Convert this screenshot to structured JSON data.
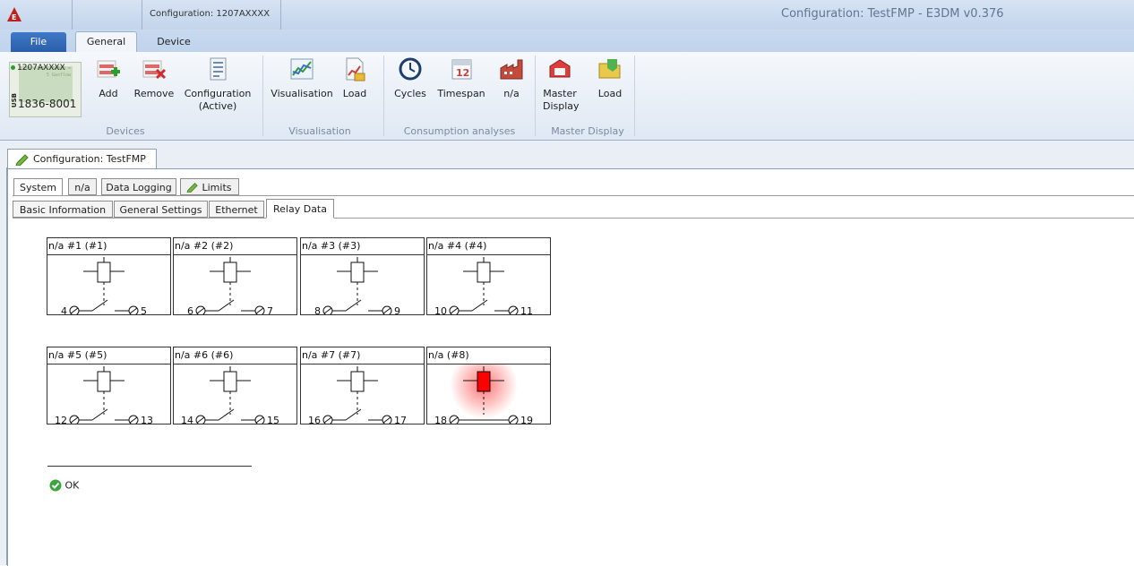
{
  "window": {
    "document_title": "Configuration: 1207AXXXX",
    "app_title": "Configuration: TestFMP - E3DM v0.376"
  },
  "ribbon_tabs": {
    "file": "File",
    "general": "General",
    "device": "Device"
  },
  "ribbon": {
    "device_tile": {
      "name": "1207AXXXX",
      "usb_label": "USB",
      "serial": "1836-8001",
      "lcd_text": "1738 = 23 1784320 = 5 Gasflow"
    },
    "devices": {
      "add": "Add",
      "remove": "Remove",
      "configuration": "Configuration",
      "configuration_sub": "(Active)",
      "group_label": "Devices"
    },
    "visualisation": {
      "visualisation": "Visualisation",
      "load": "Load",
      "group_label": "Visualisation"
    },
    "consumption": {
      "cycles": "Cycles",
      "timespan": "Timespan",
      "timespan_day": "12",
      "na": "n/a",
      "group_label": "Consumption analyses"
    },
    "master_display": {
      "master": "Master",
      "display": "Display",
      "load": "Load",
      "group_label": "Master Display"
    }
  },
  "document_tab": "Configuration: TestFMP",
  "config_tabs": [
    "System",
    "n/a",
    "Data Logging",
    "Limits"
  ],
  "sub_tabs": [
    "Basic Information",
    "General Settings",
    "Ethernet",
    "Relay Data"
  ],
  "relays": [
    {
      "name": "n/a #1 (#1)",
      "terminal_left": "4",
      "terminal_right": "5",
      "active": false
    },
    {
      "name": "n/a #2 (#2)",
      "terminal_left": "6",
      "terminal_right": "7",
      "active": false
    },
    {
      "name": "n/a #3 (#3)",
      "terminal_left": "8",
      "terminal_right": "9",
      "active": false
    },
    {
      "name": "n/a #4 (#4)",
      "terminal_left": "10",
      "terminal_right": "11",
      "active": false
    },
    {
      "name": "n/a #5 (#5)",
      "terminal_left": "12",
      "terminal_right": "13",
      "active": false
    },
    {
      "name": "n/a #6 (#6)",
      "terminal_left": "14",
      "terminal_right": "15",
      "active": false
    },
    {
      "name": "n/a #7 (#7)",
      "terminal_left": "16",
      "terminal_right": "17",
      "active": false
    },
    {
      "name": "n/a (#8)",
      "terminal_left": "18",
      "terminal_right": "19",
      "active": true
    }
  ],
  "status": {
    "text": "OK",
    "color": "#3aa53a"
  },
  "colors": {
    "accent": "#2a5ea9",
    "relay_active": "#ff0000"
  }
}
